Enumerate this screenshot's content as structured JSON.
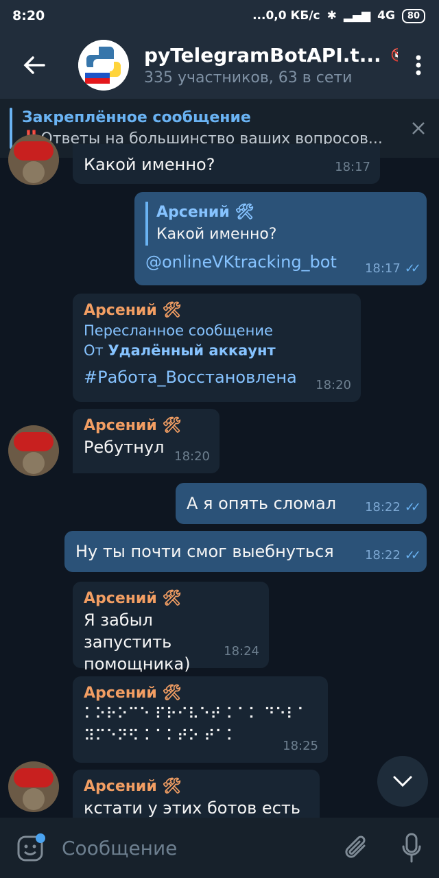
{
  "status": {
    "time": "8:20",
    "network": "...0,0 КБ/с",
    "signal": "4G",
    "battery": "80"
  },
  "header": {
    "title": "pyTelegramBotAPI.t...",
    "subtitle": "335 участников, 63 в сети"
  },
  "pinned": {
    "title": "Закреплённое сообщение",
    "text": "‼️Ответы на большинство ваших вопросов..."
  },
  "messages": [
    {
      "text": "Какой именно?",
      "time": "18:17"
    },
    {
      "reply_name": "Арсений 🛠",
      "reply_text": "Какой именно?",
      "text": "@onlineVKtracking_bot",
      "time": "18:17"
    },
    {
      "sender": "Арсений 🛠",
      "fwd_label": "Пересланное сообщение",
      "fwd_from_prefix": "От",
      "fwd_from": "Удалённый аккаунт",
      "text": "#Работа_Восстановлена",
      "time": "18:20"
    },
    {
      "sender": "Арсений 🛠",
      "text": "Ребутнул",
      "time": "18:20"
    },
    {
      "text": "А я опять сломал",
      "time": "18:22"
    },
    {
      "text": "Ну ты почти смог выебнуться",
      "time": "18:22"
    },
    {
      "sender": "Арсений 🛠",
      "text": "Я забыл запустить помощника)",
      "time": "18:24"
    },
    {
      "sender": "Арсений 🛠",
      "line1": "⠅⠕⠗⠕⠉⠑ ⠏⠗⠊⠧⠑⠞ ⠅⠁⠅ ⠙⠑⠇⠁",
      "line2": "⠽⠍⠑⠝⠫ ⠅⠁⠅⠞⠕ ⠞⠁⠅",
      "time": "18:25"
    },
    {
      "sender": "Арсений 🛠",
      "text": "кстати у этих ботов есть"
    }
  ],
  "input": {
    "placeholder": "Сообщение"
  },
  "colors": {
    "bg": "#0e1621",
    "in_bubble": "#182533",
    "out_bubble": "#2b5278",
    "accent": "#6ab3f3",
    "sender": "#f29e63"
  }
}
